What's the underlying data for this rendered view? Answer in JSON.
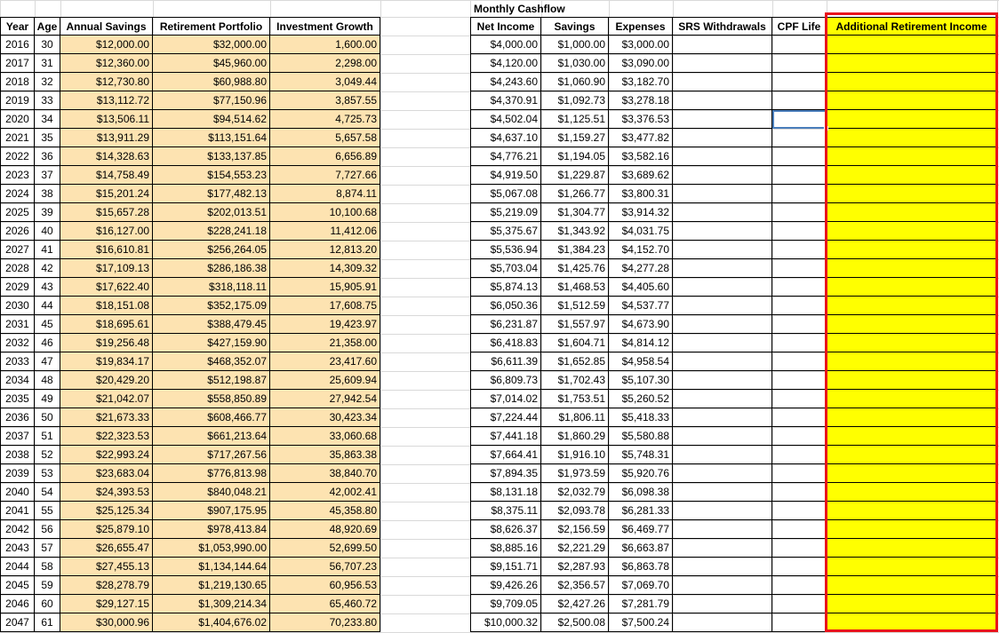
{
  "left_table": {
    "headers": [
      "Year",
      "Age",
      "Annual Savings",
      "Retirement Portfolio",
      "Investment Growth"
    ],
    "rows": [
      [
        "2016",
        "30",
        "$12,000.00",
        "$32,000.00",
        "1,600.00"
      ],
      [
        "2017",
        "31",
        "$12,360.00",
        "$45,960.00",
        "2,298.00"
      ],
      [
        "2018",
        "32",
        "$12,730.80",
        "$60,988.80",
        "3,049.44"
      ],
      [
        "2019",
        "33",
        "$13,112.72",
        "$77,150.96",
        "3,857.55"
      ],
      [
        "2020",
        "34",
        "$13,506.11",
        "$94,514.62",
        "4,725.73"
      ],
      [
        "2021",
        "35",
        "$13,911.29",
        "$113,151.64",
        "5,657.58"
      ],
      [
        "2022",
        "36",
        "$14,328.63",
        "$133,137.85",
        "6,656.89"
      ],
      [
        "2023",
        "37",
        "$14,758.49",
        "$154,553.23",
        "7,727.66"
      ],
      [
        "2024",
        "38",
        "$15,201.24",
        "$177,482.13",
        "8,874.11"
      ],
      [
        "2025",
        "39",
        "$15,657.28",
        "$202,013.51",
        "10,100.68"
      ],
      [
        "2026",
        "40",
        "$16,127.00",
        "$228,241.18",
        "11,412.06"
      ],
      [
        "2027",
        "41",
        "$16,610.81",
        "$256,264.05",
        "12,813.20"
      ],
      [
        "2028",
        "42",
        "$17,109.13",
        "$286,186.38",
        "14,309.32"
      ],
      [
        "2029",
        "43",
        "$17,622.40",
        "$318,118.11",
        "15,905.91"
      ],
      [
        "2030",
        "44",
        "$18,151.08",
        "$352,175.09",
        "17,608.75"
      ],
      [
        "2031",
        "45",
        "$18,695.61",
        "$388,479.45",
        "19,423.97"
      ],
      [
        "2032",
        "46",
        "$19,256.48",
        "$427,159.90",
        "21,358.00"
      ],
      [
        "2033",
        "47",
        "$19,834.17",
        "$468,352.07",
        "23,417.60"
      ],
      [
        "2034",
        "48",
        "$20,429.20",
        "$512,198.87",
        "25,609.94"
      ],
      [
        "2035",
        "49",
        "$21,042.07",
        "$558,850.89",
        "27,942.54"
      ],
      [
        "2036",
        "50",
        "$21,673.33",
        "$608,466.77",
        "30,423.34"
      ],
      [
        "2037",
        "51",
        "$22,323.53",
        "$661,213.64",
        "33,060.68"
      ],
      [
        "2038",
        "52",
        "$22,993.24",
        "$717,267.56",
        "35,863.38"
      ],
      [
        "2039",
        "53",
        "$23,683.04",
        "$776,813.98",
        "38,840.70"
      ],
      [
        "2040",
        "54",
        "$24,393.53",
        "$840,048.21",
        "42,002.41"
      ],
      [
        "2041",
        "55",
        "$25,125.34",
        "$907,175.95",
        "45,358.80"
      ],
      [
        "2042",
        "56",
        "$25,879.10",
        "$978,413.84",
        "48,920.69"
      ],
      [
        "2043",
        "57",
        "$26,655.47",
        "$1,053,990.00",
        "52,699.50"
      ],
      [
        "2044",
        "58",
        "$27,455.13",
        "$1,134,144.64",
        "56,707.23"
      ],
      [
        "2045",
        "59",
        "$28,278.79",
        "$1,219,130.65",
        "60,956.53"
      ],
      [
        "2046",
        "60",
        "$29,127.15",
        "$1,309,214.34",
        "65,460.72"
      ],
      [
        "2047",
        "61",
        "$30,000.96",
        "$1,404,676.02",
        "70,233.80"
      ]
    ]
  },
  "right_table": {
    "title": "Monthly Cashflow",
    "headers": [
      "Net Income",
      "Savings",
      "Expenses",
      "SRS Withdrawals",
      "CPF Life",
      "Additional Retirement Income"
    ],
    "rows": [
      [
        "$4,000.00",
        "$1,000.00",
        "$3,000.00"
      ],
      [
        "$4,120.00",
        "$1,030.00",
        "$3,090.00"
      ],
      [
        "$4,243.60",
        "$1,060.90",
        "$3,182.70"
      ],
      [
        "$4,370.91",
        "$1,092.73",
        "$3,278.18"
      ],
      [
        "$4,502.04",
        "$1,125.51",
        "$3,376.53"
      ],
      [
        "$4,637.10",
        "$1,159.27",
        "$3,477.82"
      ],
      [
        "$4,776.21",
        "$1,194.05",
        "$3,582.16"
      ],
      [
        "$4,919.50",
        "$1,229.87",
        "$3,689.62"
      ],
      [
        "$5,067.08",
        "$1,266.77",
        "$3,800.31"
      ],
      [
        "$5,219.09",
        "$1,304.77",
        "$3,914.32"
      ],
      [
        "$5,375.67",
        "$1,343.92",
        "$4,031.75"
      ],
      [
        "$5,536.94",
        "$1,384.23",
        "$4,152.70"
      ],
      [
        "$5,703.04",
        "$1,425.76",
        "$4,277.28"
      ],
      [
        "$5,874.13",
        "$1,468.53",
        "$4,405.60"
      ],
      [
        "$6,050.36",
        "$1,512.59",
        "$4,537.77"
      ],
      [
        "$6,231.87",
        "$1,557.97",
        "$4,673.90"
      ],
      [
        "$6,418.83",
        "$1,604.71",
        "$4,814.12"
      ],
      [
        "$6,611.39",
        "$1,652.85",
        "$4,958.54"
      ],
      [
        "$6,809.73",
        "$1,702.43",
        "$5,107.30"
      ],
      [
        "$7,014.02",
        "$1,753.51",
        "$5,260.52"
      ],
      [
        "$7,224.44",
        "$1,806.11",
        "$5,418.33"
      ],
      [
        "$7,441.18",
        "$1,860.29",
        "$5,580.88"
      ],
      [
        "$7,664.41",
        "$1,916.10",
        "$5,748.31"
      ],
      [
        "$7,894.35",
        "$1,973.59",
        "$5,920.76"
      ],
      [
        "$8,131.18",
        "$2,032.79",
        "$6,098.38"
      ],
      [
        "$8,375.11",
        "$2,093.78",
        "$6,281.33"
      ],
      [
        "$8,626.37",
        "$2,156.59",
        "$6,469.77"
      ],
      [
        "$8,885.16",
        "$2,221.29",
        "$6,663.87"
      ],
      [
        "$9,151.71",
        "$2,287.93",
        "$6,863.78"
      ],
      [
        "$9,426.26",
        "$2,356.57",
        "$7,069.70"
      ],
      [
        "$9,709.05",
        "$2,427.26",
        "$7,281.79"
      ],
      [
        "$10,000.32",
        "$2,500.08",
        "$7,500.24"
      ]
    ]
  },
  "colors": {
    "tan_fill": "#fde3b1",
    "highlight_fill": "#ffff00",
    "highlight_border": "#e8141b",
    "selection": "#4a7ebb"
  }
}
